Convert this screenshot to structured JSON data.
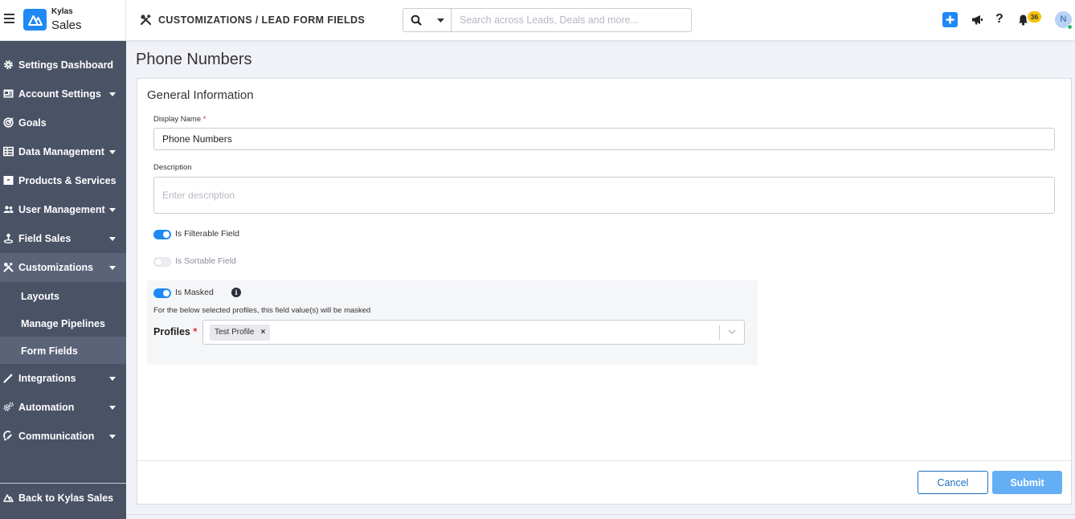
{
  "header": {
    "brand_top": "Kylas",
    "brand_bottom": "Sales",
    "breadcrumb": "CUSTOMIZATIONS / LEAD FORM FIELDS",
    "search_placeholder": "Search across Leads, Deals and more...",
    "notification_count": "36",
    "avatar_initial": "N",
    "help_glyph": "?"
  },
  "sidebar": {
    "items": [
      {
        "label": "Settings Dashboard",
        "icon": "gear-icon"
      },
      {
        "label": "Account Settings",
        "icon": "account-icon"
      },
      {
        "label": "Goals",
        "icon": "target-icon"
      },
      {
        "label": "Data Management",
        "icon": "table-icon"
      },
      {
        "label": "Products & Services",
        "icon": "box-icon"
      },
      {
        "label": "User Management",
        "icon": "users-icon"
      },
      {
        "label": "Field Sales",
        "icon": "map-pin-icon"
      },
      {
        "label": "Customizations",
        "icon": "tools-icon"
      },
      {
        "label": "Integrations",
        "icon": "magic-wand-icon"
      },
      {
        "label": "Automation",
        "icon": "cogs-icon"
      },
      {
        "label": "Communication",
        "icon": "satellite-icon"
      }
    ],
    "sub_items": [
      "Layouts",
      "Manage Pipelines",
      "Form Fields"
    ],
    "back_label": "Back to Kylas Sales"
  },
  "main": {
    "page_title": "Phone Numbers",
    "section_title": "General Information",
    "display_name_label": "Display Name",
    "required_mark": "*",
    "display_name_value": "Phone Numbers",
    "description_label": "Description",
    "description_placeholder": "Enter description",
    "filterable_label": "Is Filterable Field",
    "sortable_label": "Is Sortable Field",
    "masked_label": "Is Masked",
    "info_glyph": "i",
    "mask_note": "For the below selected profiles, this field value(s) will be masked",
    "profiles_label": "Profiles",
    "selected_profile": "Test Profile",
    "chip_remove": "×",
    "cancel_label": "Cancel",
    "submit_label": "Submit"
  },
  "colors": {
    "accent": "#1e88f5",
    "sidebar_bg": "#4a5266",
    "sidebar_active": "#5b6378",
    "submit_bg": "#64aef5",
    "badge": "#f6c20d"
  }
}
